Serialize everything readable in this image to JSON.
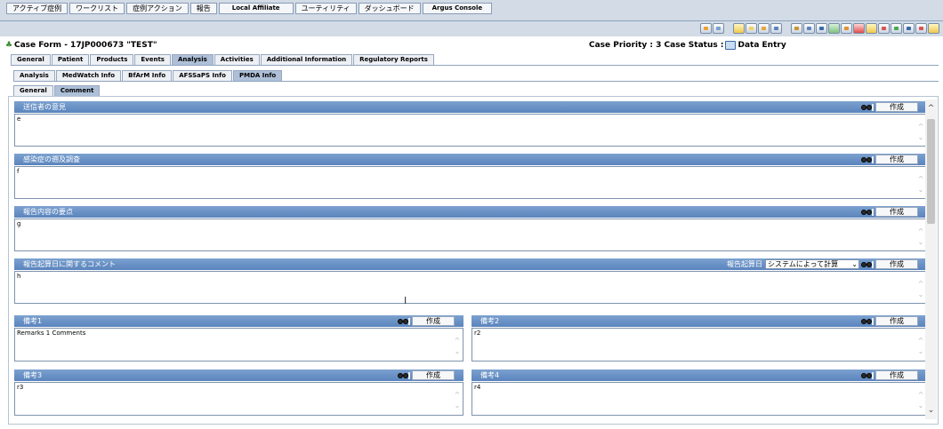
{
  "menu": {
    "items": [
      {
        "label": "アクティブ症例",
        "bold": false
      },
      {
        "label": "ワークリスト",
        "bold": false
      },
      {
        "label": "症例アクション",
        "bold": false
      },
      {
        "label": "報告",
        "bold": false
      },
      {
        "label": "Local Affiliate",
        "bold": true
      },
      {
        "label": "ユーティリティ",
        "bold": false
      },
      {
        "label": "ダッシュボード",
        "bold": false
      },
      {
        "label": "Argus Console",
        "bold": true
      }
    ]
  },
  "case": {
    "title": "Case Form - 17JP000673 \"TEST\"",
    "priority_status": "Case Priority : 3 Case Status :",
    "status_value": "Data Entry"
  },
  "tabs": [
    "General",
    "Patient",
    "Products",
    "Events",
    "Analysis",
    "Activities",
    "Additional Information",
    "Regulatory Reports"
  ],
  "subtabs": [
    "Analysis",
    "MedWatch Info",
    "BfArM Info",
    "AFSSaPS Info",
    "PMDA Info"
  ],
  "subsubtabs": [
    "General",
    "Comment"
  ],
  "sections": {
    "sender_opinion": {
      "label": "送信者の意見",
      "value": "e"
    },
    "infection_survey": {
      "label": "感染症の遡及調査",
      "value": "f"
    },
    "report_summary": {
      "label": "報告内容の要点",
      "value": "g"
    },
    "reckoning_comment": {
      "label": "報告起算日に関するコメント",
      "value": "h",
      "date_label": "報告起算日",
      "date_option": "システムによって計算"
    }
  },
  "remarks": {
    "r1": {
      "label": "備考1",
      "value": "Remarks 1 Comments"
    },
    "r2": {
      "label": "備考2",
      "value": "r2"
    },
    "r3": {
      "label": "備考3",
      "value": "r3"
    },
    "r4": {
      "label": "備考4",
      "value": "r4"
    }
  },
  "create_label": "作成",
  "select_arrow": "⌄",
  "scroll": {
    "up": "^",
    "down": "⌄"
  },
  "scroll_arrows": {
    "up": "^",
    "down": "⌄"
  },
  "icons": {
    "toolbar": [
      "translate-icon",
      "print-preview-icon",
      "mail-icon",
      "new-doc-icon",
      "open-folder-icon",
      "list-icon",
      "save-icon",
      "print-icon",
      "floppy-icon",
      "add-icon",
      "edit-icon",
      "record-icon",
      "chart-icon",
      "report-icon",
      "chart2-icon",
      "csv-icon",
      "check-icon",
      "help-icon"
    ]
  },
  "colors": {
    "menubar_bg": "#d2dbe6",
    "section_header": "#5a84bd",
    "active_tab": "#aec0d8"
  }
}
